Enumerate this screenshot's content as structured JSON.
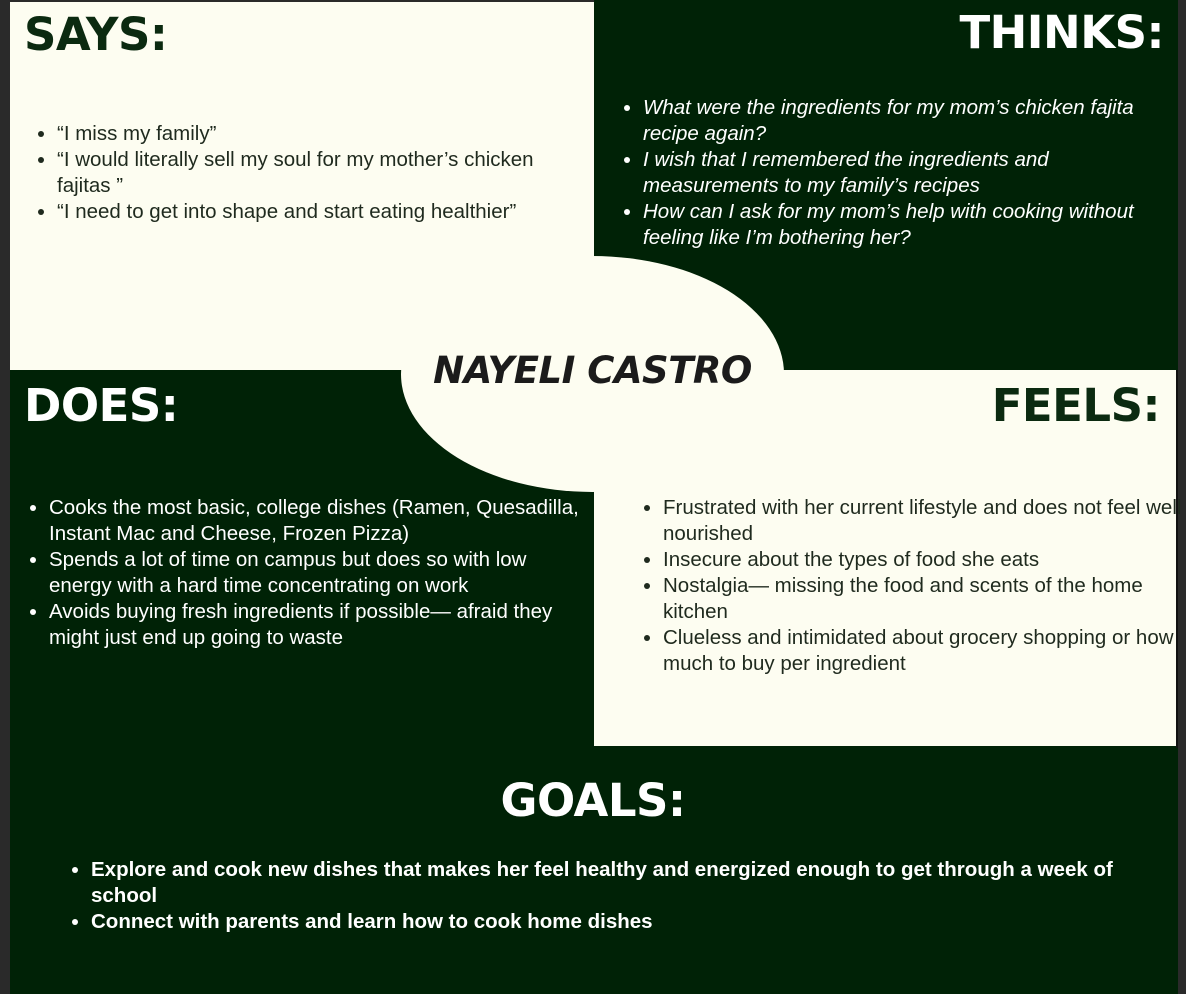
{
  "says": {
    "heading": "SAYS:",
    "items": [
      "“I miss my family”",
      "“I would literally sell my soul for my mother’s chicken fajitas ”",
      "“I need to get into shape and start eating healthier”"
    ]
  },
  "thinks": {
    "heading": "THINKS:",
    "items": [
      "What were the ingredients for my mom’s chicken fajita recipe again?",
      "I wish that I remembered the ingredients and measurements to my family’s recipes",
      "How can I ask for my mom’s help with cooking without feeling like I’m bothering her?"
    ]
  },
  "center": {
    "name": "NAYELI CASTRO"
  },
  "does": {
    "heading": "DOES:",
    "items": [
      "Cooks the most basic, college dishes (Ramen, Quesadilla, Instant Mac and Cheese, Frozen Pizza)",
      "Spends a lot of time on campus but does so with low energy with a hard time concentrating on work",
      "Avoids buying fresh ingredients if possible— afraid they might just end up going to waste"
    ]
  },
  "feels": {
    "heading": "FEELS:",
    "items": [
      "Frustrated with her current lifestyle and does not feel well nourished",
      "Insecure about the types of food she eats",
      "Nostalgia— missing the food and scents of the home kitchen",
      "Clueless and intimidated about grocery shopping or how much to buy per ingredient"
    ]
  },
  "goals": {
    "heading": "GOALS:",
    "items": [
      "Explore and cook new dishes that makes her feel healthy and energized enough to get through a week of school",
      "Connect with parents and learn how to cook home dishes"
    ]
  },
  "colors": {
    "dark_green": "#002206",
    "cream": "#fdfdf1",
    "heading_dark": "#0b2a10"
  }
}
